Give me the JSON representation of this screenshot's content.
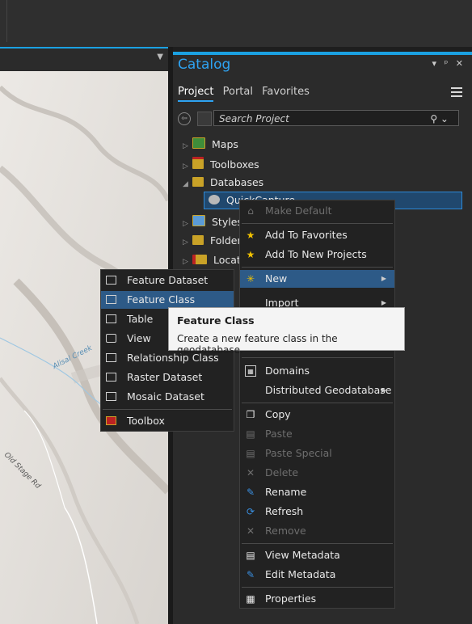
{
  "catalog": {
    "title": "Catalog",
    "window_controls": "▾ ᵖ ✕",
    "tabs": [
      "Project",
      "Portal",
      "Favorites"
    ],
    "search_placeholder": "Search Project",
    "tree": [
      {
        "label": "Maps"
      },
      {
        "label": "Toolboxes"
      },
      {
        "label": "Databases"
      },
      {
        "label": "QuickCapture..."
      },
      {
        "label": "Styles"
      },
      {
        "label": "Folders"
      },
      {
        "label": "Locators"
      }
    ]
  },
  "map": {
    "labels": [
      "Alisal Creek",
      "Old Stage Rd"
    ]
  },
  "context_menu": {
    "items": [
      {
        "label": "Make Default",
        "icon": "home-icon",
        "disabled": true
      },
      {
        "label": "Add To Favorites",
        "icon": "star-icon"
      },
      {
        "label": "Add To New Projects",
        "icon": "star-icon"
      },
      {
        "label": "New",
        "icon": "sparkle-icon",
        "submenu": true
      },
      {
        "label": "Import",
        "submenu": true
      },
      {
        "label": "Domains",
        "icon": "domains-icon"
      },
      {
        "label": "Distributed Geodatabase",
        "submenu": true
      },
      {
        "label": "Copy",
        "icon": "copy-icon"
      },
      {
        "label": "Paste",
        "icon": "paste-icon",
        "disabled": true
      },
      {
        "label": "Paste Special",
        "icon": "paste-icon",
        "disabled": true
      },
      {
        "label": "Delete",
        "icon": "delete-icon",
        "disabled": true
      },
      {
        "label": "Rename",
        "icon": "pencil-icon"
      },
      {
        "label": "Refresh",
        "icon": "refresh-icon"
      },
      {
        "label": "Remove",
        "icon": "remove-icon",
        "disabled": true
      },
      {
        "label": "View Metadata",
        "icon": "metadata-icon"
      },
      {
        "label": "Edit Metadata",
        "icon": "pencil-icon"
      },
      {
        "label": "Properties",
        "icon": "properties-icon"
      }
    ]
  },
  "new_submenu": {
    "items": [
      {
        "label": "Feature Dataset"
      },
      {
        "label": "Feature Class"
      },
      {
        "label": "Table"
      },
      {
        "label": "View"
      },
      {
        "label": "Relationship Class"
      },
      {
        "label": "Raster Dataset"
      },
      {
        "label": "Mosaic Dataset"
      },
      {
        "label": "Toolbox"
      }
    ]
  },
  "tooltip": {
    "title": "Feature Class",
    "text": "Create a new feature class in the geodatabase."
  },
  "colors": {
    "accent": "#1ba1e2",
    "highlight": "#2d5a87",
    "star": "#f2c200"
  }
}
